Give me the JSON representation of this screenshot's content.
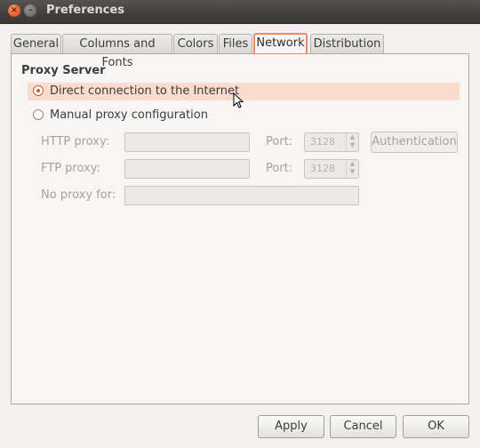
{
  "window": {
    "title": "Preferences"
  },
  "tabs": [
    {
      "label": "General"
    },
    {
      "label": "Columns and Fonts"
    },
    {
      "label": "Colors"
    },
    {
      "label": "Files"
    },
    {
      "label": "Network",
      "active": true
    },
    {
      "label": "Distribution"
    }
  ],
  "proxy": {
    "section_title": "Proxy Server",
    "direct_label": "Direct connection to the Internet",
    "manual_label": "Manual proxy configuration",
    "selected": "direct",
    "http_label": "HTTP proxy:",
    "http_value": "",
    "http_port_label": "Port:",
    "http_port_value": "3128",
    "ftp_label": "FTP proxy:",
    "ftp_value": "",
    "ftp_port_label": "Port:",
    "ftp_port_value": "3128",
    "noproxy_label": "No proxy for:",
    "noproxy_value": "",
    "auth_button": "Authentication"
  },
  "footer": {
    "apply": "Apply",
    "cancel": "Cancel",
    "ok": "OK"
  },
  "colors": {
    "accent": "#e2571f",
    "highlight": "#f9dccd"
  }
}
